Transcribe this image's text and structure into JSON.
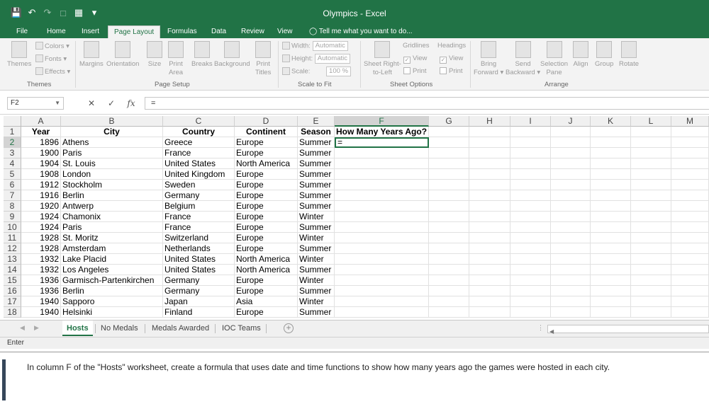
{
  "window": {
    "title": "Olympics - Excel"
  },
  "quick_access": {
    "icons": [
      "save-icon",
      "undo-icon",
      "redo-icon",
      "print-preview-icon",
      "customize-icon"
    ]
  },
  "tabs": [
    {
      "label": "File"
    },
    {
      "label": "Home"
    },
    {
      "label": "Insert"
    },
    {
      "label": "Page Layout"
    },
    {
      "label": "Formulas"
    },
    {
      "label": "Data"
    },
    {
      "label": "Review"
    },
    {
      "label": "View"
    }
  ],
  "tell_me": "Tell me what you want to do...",
  "ribbon": {
    "themes": {
      "themes_label": "Themes",
      "colors": "Colors",
      "fonts": "Fonts",
      "effects": "Effects",
      "group": "Themes"
    },
    "page_setup": {
      "margins": "Margins",
      "orientation": "Orientation",
      "size": "Size",
      "print_area_1": "Print",
      "print_area_2": "Area",
      "breaks": "Breaks",
      "background": "Background",
      "print_titles_1": "Print",
      "print_titles_2": "Titles",
      "group": "Page Setup"
    },
    "scale_to_fit": {
      "width_label": "Width:",
      "width_value": "Automatic",
      "height_label": "Height:",
      "height_value": "Automatic",
      "scale_label": "Scale:",
      "scale_value": "100 %",
      "group": "Scale to Fit"
    },
    "sheet_options": {
      "rtl_1": "Sheet Right-",
      "rtl_2": "to-Left",
      "gridlines": "Gridlines",
      "headings": "Headings",
      "view": "View",
      "print": "Print",
      "group": "Sheet Options"
    },
    "arrange": {
      "bring_1": "Bring",
      "bring_2": "Forward",
      "send_1": "Send",
      "send_2": "Backward",
      "selection_1": "Selection",
      "selection_2": "Pane",
      "align": "Align",
      "group_btn": "Group",
      "rotate": "Rotate",
      "group": "Arrange"
    }
  },
  "formula_bar": {
    "name_box": "F2",
    "formula": "="
  },
  "columns": [
    "A",
    "B",
    "C",
    "D",
    "E",
    "F",
    "G",
    "H",
    "I",
    "J",
    "K",
    "L",
    "M"
  ],
  "headers": [
    "Year",
    "City",
    "Country",
    "Continent",
    "Season",
    "How Many Years Ago?"
  ],
  "rows": [
    {
      "n": "1"
    },
    {
      "n": "2",
      "year": "1896",
      "city": "Athens",
      "country": "Greece",
      "continent": "Europe",
      "season": "Summer",
      "f": "="
    },
    {
      "n": "3",
      "year": "1900",
      "city": "Paris",
      "country": "France",
      "continent": "Europe",
      "season": "Summer"
    },
    {
      "n": "4",
      "year": "1904",
      "city": "St. Louis",
      "country": "United States",
      "continent": "North America",
      "season": "Summer"
    },
    {
      "n": "5",
      "year": "1908",
      "city": "London",
      "country": "United Kingdom",
      "continent": "Europe",
      "season": "Summer"
    },
    {
      "n": "6",
      "year": "1912",
      "city": "Stockholm",
      "country": "Sweden",
      "continent": "Europe",
      "season": "Summer"
    },
    {
      "n": "7",
      "year": "1916",
      "city": "Berlin",
      "country": "Germany",
      "continent": "Europe",
      "season": "Summer"
    },
    {
      "n": "8",
      "year": "1920",
      "city": "Antwerp",
      "country": "Belgium",
      "continent": "Europe",
      "season": "Summer"
    },
    {
      "n": "9",
      "year": "1924",
      "city": "Chamonix",
      "country": "France",
      "continent": "Europe",
      "season": "Winter"
    },
    {
      "n": "10",
      "year": "1924",
      "city": "Paris",
      "country": "France",
      "continent": "Europe",
      "season": "Summer"
    },
    {
      "n": "11",
      "year": "1928",
      "city": "St. Moritz",
      "country": "Switzerland",
      "continent": "Europe",
      "season": "Winter"
    },
    {
      "n": "12",
      "year": "1928",
      "city": "Amsterdam",
      "country": "Netherlands",
      "continent": "Europe",
      "season": "Summer"
    },
    {
      "n": "13",
      "year": "1932",
      "city": "Lake Placid",
      "country": "United States",
      "continent": "North America",
      "season": "Winter"
    },
    {
      "n": "14",
      "year": "1932",
      "city": "Los Angeles",
      "country": "United States",
      "continent": "North America",
      "season": "Summer"
    },
    {
      "n": "15",
      "year": "1936",
      "city": "Garmisch-Partenkirchen",
      "country": "Germany",
      "continent": "Europe",
      "season": "Winter"
    },
    {
      "n": "16",
      "year": "1936",
      "city": "Berlin",
      "country": "Germany",
      "continent": "Europe",
      "season": "Summer"
    },
    {
      "n": "17",
      "year": "1940",
      "city": "Sapporo",
      "country": "Japan",
      "continent": "Asia",
      "season": "Winter"
    },
    {
      "n": "18",
      "year": "1940",
      "city": "Helsinki",
      "country": "Finland",
      "continent": "Europe",
      "season": "Summer"
    }
  ],
  "sheets": [
    {
      "label": "Hosts",
      "active": true
    },
    {
      "label": "No Medals"
    },
    {
      "label": "Medals Awarded"
    },
    {
      "label": "IOC Teams"
    }
  ],
  "status": "Enter",
  "task": "In column F of the \"Hosts\" worksheet, create a formula that uses date and time functions to show how many years ago the games were hosted in each city.",
  "colors": {
    "accent": "#217346",
    "task_bar": "#36475a"
  }
}
